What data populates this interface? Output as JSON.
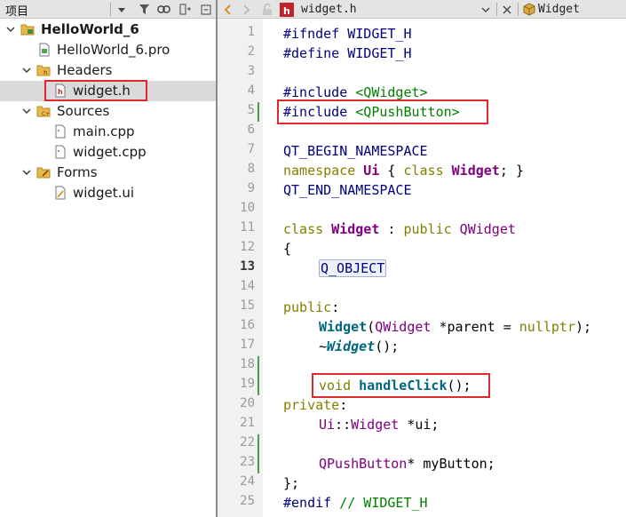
{
  "project_panel": {
    "title": "项目",
    "tree": [
      {
        "label": "HelloWorld_6",
        "type": "project"
      },
      {
        "label": "HelloWorld_6.pro",
        "type": "pro-file"
      },
      {
        "label": "Headers",
        "type": "folder"
      },
      {
        "label": "widget.h",
        "type": "header-file"
      },
      {
        "label": "Sources",
        "type": "folder"
      },
      {
        "label": "main.cpp",
        "type": "source-file"
      },
      {
        "label": "widget.cpp",
        "type": "source-file"
      },
      {
        "label": "Forms",
        "type": "folder"
      },
      {
        "label": "widget.ui",
        "type": "form-file"
      }
    ]
  },
  "editor": {
    "file_tab": "widget.h",
    "symbol": "Widget",
    "current_line": 13,
    "line_numbers": [
      "1",
      "2",
      "3",
      "4",
      "5",
      "6",
      "7",
      "8",
      "9",
      "10",
      "11",
      "12",
      "13",
      "14",
      "15",
      "16",
      "17",
      "18",
      "19",
      "20",
      "21",
      "22",
      "23",
      "24",
      "25"
    ],
    "code": {
      "l1a": "#ifndef",
      "l1b": " WIDGET_H",
      "l2a": "#define",
      "l2b": " WIDGET_H",
      "l4a": "#include",
      "l4b": " <QWidget>",
      "l5a": "#include",
      "l5b": " <QPushButton>",
      "l7": "QT_BEGIN_NAMESPACE",
      "l8a": "namespace",
      "l8b": " Ui ",
      "l8c": "{ ",
      "l8d": "class",
      "l8e": " Widget",
      "l8f": "; }",
      "l9": "QT_END_NAMESPACE",
      "l11a": "class",
      "l11b": " Widget",
      "l11c": " : ",
      "l11d": "public",
      "l11e": " QWidget",
      "l12": "{",
      "l13": "Q_OBJECT",
      "l15a": "public",
      "l15b": ":",
      "l16a": "Widget",
      "l16b": "(",
      "l16c": "QWidget",
      "l16d": " *parent = ",
      "l16e": "nullptr",
      "l16f": ");",
      "l17a": "~",
      "l17b": "Widget",
      "l17c": "();",
      "l19a": "void",
      "l19b": " handleClick",
      "l19c": "();",
      "l20a": "private",
      "l20b": ":",
      "l21a": "Ui",
      "l21b": "::",
      "l21c": "Widget",
      "l21d": " *ui;",
      "l23a": "QPushButton",
      "l23b": "* myButton;",
      "l24": "};",
      "l25a": "#endif",
      "l25b": " // WIDGET_H"
    }
  },
  "colors": {
    "highlight_box": "#e0282d",
    "change_marker": "#44a049",
    "selected_row": "#dadada"
  }
}
